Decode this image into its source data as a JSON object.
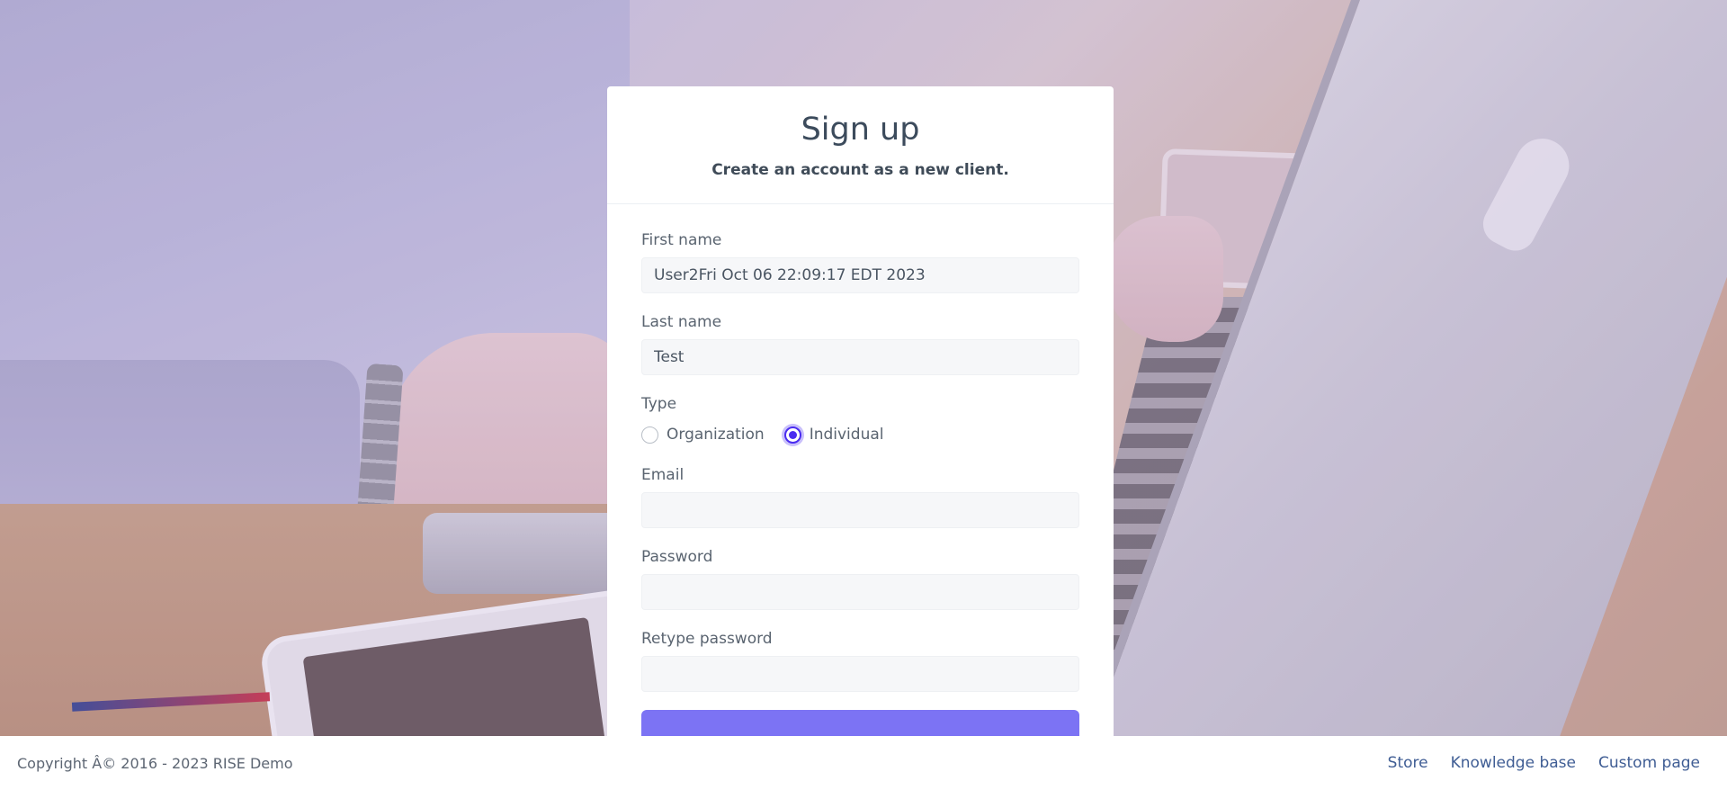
{
  "signup": {
    "title": "Sign up",
    "subtitle": "Create an account as a new client.",
    "fields": {
      "first_name": {
        "label": "First name",
        "value": "User2Fri Oct 06 22:09:17 EDT 2023"
      },
      "last_name": {
        "label": "Last name",
        "value": "Test"
      },
      "email": {
        "label": "Email",
        "value": ""
      },
      "password": {
        "label": "Password",
        "value": ""
      },
      "retype_password": {
        "label": "Retype password",
        "value": ""
      }
    },
    "type": {
      "label": "Type",
      "options": [
        "Organization",
        "Individual"
      ],
      "selected": "Individual"
    },
    "accent_color": "#4a2cf0",
    "button_color": "#7c73f4"
  },
  "footer": {
    "copyright": "Copyright Â© 2016 - 2023 RISE Demo",
    "links": [
      "Store",
      "Knowledge base",
      "Custom page"
    ]
  }
}
